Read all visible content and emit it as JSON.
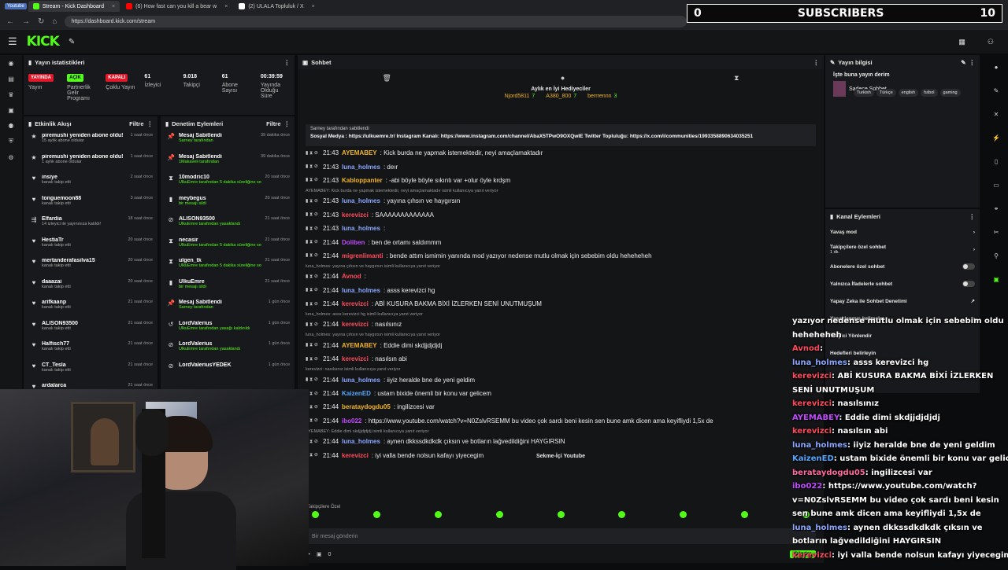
{
  "browser": {
    "tabs": [
      {
        "label": "Youtube",
        "kind": "badge"
      },
      {
        "label": "Stream - Kick Dashboard",
        "active": true,
        "color": "#53fc18"
      },
      {
        "label": "(6) How fast can you kill a bear w",
        "color": "#ff0000"
      },
      {
        "label": "(2) ULALA Topluluk / X",
        "color": "#ffffff"
      }
    ],
    "url": "https://dashboard.kick.com/stream"
  },
  "app": {
    "logo": "KICK"
  },
  "subscribers": {
    "left": "0",
    "label": "SUBSCRIBERS",
    "right": "10"
  },
  "stats": {
    "title": "Yayın istatistikleri",
    "items": [
      {
        "badge": "YAYINDA",
        "label": "Yayın",
        "color": "#e0182a"
      },
      {
        "badge": "AÇIK",
        "label": "Partnerlik Gelir Programı",
        "color": "#53fc18"
      },
      {
        "badge": "KAPALI",
        "label": "Çoklu Yayın",
        "color": "#e0182a"
      },
      {
        "value": "61",
        "label": "İzleyici"
      },
      {
        "value": "9.018",
        "label": "Takipçi"
      },
      {
        "value": "61",
        "label": "Abone Sayısı"
      },
      {
        "value": "00:39:59",
        "label": "Yayında Olduğu Süre"
      }
    ]
  },
  "feed": {
    "title": "Etkinlik Akışı",
    "filter": "Filtre",
    "items": [
      {
        "name": "piremushi yeniden abone oldu!",
        "sub": "15 aylık abone oldular",
        "time": "1 saat önce",
        "icon": "star"
      },
      {
        "name": "piremushi yeniden abone oldu!",
        "sub": "1 aylık abone oldular",
        "time": "1 saat önce",
        "icon": "star"
      },
      {
        "name": "insiye",
        "sub": "kanalı takip etti",
        "time": "2 saat önce",
        "icon": "heart"
      },
      {
        "name": "tonguemoon88",
        "sub": "kanalı takip etti",
        "time": "3 saat önce",
        "icon": "heart"
      },
      {
        "name": "Elfardia",
        "sub": "14 izleyici ile yayınınıza katıldı!",
        "time": "18 saat önce",
        "icon": "raid"
      },
      {
        "name": "HestiaTr",
        "sub": "kanalı takip etti",
        "time": "20 saat önce",
        "icon": "heart"
      },
      {
        "name": "mertanderafasilva15",
        "sub": "kanalı takip etti",
        "time": "20 saat önce",
        "icon": "heart"
      },
      {
        "name": "daaazai",
        "sub": "kanalı takip etti",
        "time": "20 saat önce",
        "icon": "heart"
      },
      {
        "name": "arifkaanp",
        "sub": "kanalı takip etti",
        "time": "21 saat önce",
        "icon": "heart"
      },
      {
        "name": "ALISON93500",
        "sub": "kanalı takip etti",
        "time": "21 saat önce",
        "icon": "heart"
      },
      {
        "name": "Halfisch77",
        "sub": "kanalı takip etti",
        "time": "21 saat önce",
        "icon": "heart"
      },
      {
        "name": "CT_Tesla",
        "sub": "kanalı takip etti",
        "time": "21 saat önce",
        "icon": "heart"
      },
      {
        "name": "ardalarca",
        "sub": "",
        "time": "21 saat önce",
        "icon": "heart"
      }
    ]
  },
  "mod": {
    "title": "Denetim Eylemleri",
    "filter": "Filtre",
    "items": [
      {
        "name": "Mesaj Sabitlendi",
        "sub": "Sarney tarafından",
        "time": "39 dakika önce",
        "icon": "pin"
      },
      {
        "name": "Mesaj Sabitlendi",
        "sub": "1Makaveli tarafından",
        "time": "39 dakika önce",
        "icon": "pin"
      },
      {
        "name": "10modric10",
        "sub": "UlkuEmre tarafından 5 dakika süreliğine sohbetten uzaklaştırıldı",
        "time": "20 saat önce",
        "icon": "timer"
      },
      {
        "name": "meybegus",
        "sub": "bir mesajı sildi",
        "time": "20 saat önce",
        "icon": "trash"
      },
      {
        "name": "ALISON93500",
        "sub": "UlkuEmre tarafından yasaklandı",
        "time": "21 saat önce",
        "icon": "ban"
      },
      {
        "name": "necasir",
        "sub": "UlkuEmre tarafından 5 dakika süreliğine sohbetten uzaklaştırıldı",
        "time": "21 saat önce",
        "icon": "timer"
      },
      {
        "name": "ulgen_tk",
        "sub": "UlkuEmre tarafından 5 dakika süreliğine sohbetten uzaklaştırıldı",
        "time": "21 saat önce",
        "icon": "timer"
      },
      {
        "name": "UlkuEmre",
        "sub": "bir mesajı sildi",
        "time": "21 saat önce",
        "icon": "trash"
      },
      {
        "name": "Mesaj Sabitlendi",
        "sub": "Sarney tarafından",
        "time": "1 gün önce",
        "icon": "pin"
      },
      {
        "name": "LordValerius",
        "sub": "UlkuEmre tarafından yasağı kaldırıldı",
        "time": "1 gün önce",
        "icon": "unban"
      },
      {
        "name": "LordValerius",
        "sub": "UlkuEmre tarafından yasaklandı",
        "time": "1 gün önce",
        "icon": "ban"
      },
      {
        "name": "LordValeriusYEDEK",
        "sub": "",
        "time": "1 gün önce",
        "icon": "ban"
      }
    ]
  },
  "chat": {
    "title": "Sohbet",
    "gifters_title": "Aylık en İyi Hediyeciler",
    "gifters": [
      {
        "name": "Njord5811",
        "count": "7"
      },
      {
        "name": "A380_800",
        "count": "7"
      },
      {
        "name": "berrrennn",
        "count": "3"
      }
    ],
    "pinned_by": "Sarney tarafından sabitlendi",
    "pinned_text": "Sosyal Medya : https://ulkuemre.tr/ Instagram Kanalı: https://www.instagram.com/channel/AbaX5TPwO9OXQwIE Twitter Topluluğu: https://x.com/i/communities/1993358890634035251",
    "messages": [
      {
        "time": "21:43",
        "user": "AYEMABEY",
        "color": "#f0b429",
        "text": ": Kick burda ne yapmak istemektedir, neyi amaçlamaktadır"
      },
      {
        "time": "21:43",
        "user": "luna_holmes",
        "color": "#8aa7ff",
        "text": ": deır"
      },
      {
        "time": "21:43",
        "user": "Kabloppanter",
        "color": "#f0b429",
        "text": ": -abi böyle böyle sıkıntı var +olur öyle krdşm"
      },
      {
        "reply": "AYEMABEY: Kick burda ne yapmak istemektedir, neyi amaçlamaktadır isimli kullanıcıya yanıt veriyor"
      },
      {
        "time": "21:43",
        "user": "luna_holmes",
        "color": "#8aa7ff",
        "text": ": yayına çıhsın ve haygırsın"
      },
      {
        "time": "21:43",
        "user": "kerevizci",
        "color": "#ff4b5c",
        "text": ": SAAAAAAAAAAAAA"
      },
      {
        "time": "21:43",
        "user": "luna_holmes",
        "color": "#8aa7ff",
        "text": ":"
      },
      {
        "time": "21:44",
        "user": "Doliben",
        "color": "#c24bff",
        "text": ": ben de ortamı saldımmm"
      },
      {
        "time": "21:44",
        "user": "migrenlimanti",
        "color": "#ff4b5c",
        "text": ": bende attım ismimin yanında mod yazıyor nedense mutlu olmak için sebebim oldu heheheheh"
      },
      {
        "reply": "luna_holmes: yayına çıhsın ve haygırsın isimli kullanıcıya yanıt veriyor"
      },
      {
        "time": "21:44",
        "user": "Avnod",
        "color": "#ff4b5c",
        "text": ":"
      },
      {
        "time": "21:44",
        "user": "luna_holmes",
        "color": "#8aa7ff",
        "text": ": asss kerevizci hg"
      },
      {
        "time": "21:44",
        "user": "kerevizci",
        "color": "#ff4b5c",
        "text": ": ABİ KUSURA BAKMA BİXİ İZLERKEN SENİ UNUTMUŞUM"
      },
      {
        "reply": "luna_holmes: asss kerevizci hg isimli kullanıcıya yanıt veriyor"
      },
      {
        "time": "21:44",
        "user": "kerevizci",
        "color": "#ff4b5c",
        "text": ": nasılsınız"
      },
      {
        "reply": "luna_holmes: yayına çıhsın ve haygırsın isimli kullanıcıya yanıt veriyor"
      },
      {
        "time": "21:44",
        "user": "AYEMABEY",
        "color": "#f0b429",
        "text": ": Eddie dimi skdjjdjdjdj"
      },
      {
        "time": "21:44",
        "user": "kerevizci",
        "color": "#ff4b5c",
        "text": ": nasılsın abi"
      },
      {
        "reply": "kerevizci: nasılsınız isimli kullanıcıya yanıt veriyor"
      },
      {
        "time": "21:44",
        "user": "luna_holmes",
        "color": "#8aa7ff",
        "text": ": iiyiz heralde bne de yeni geldim"
      },
      {
        "time": "21:44",
        "user": "KaizenED",
        "color": "#53a8ff",
        "text": ": ustam bixide önemli bir konu var gelicem"
      },
      {
        "time": "21:44",
        "user": "berataydogdu05",
        "color": "#f0b429",
        "text": ": ingilizcesi var"
      },
      {
        "time": "21:44",
        "user": "ibo022",
        "color": "#c24bff",
        "text": ": https://www.youtube.com/watch?v=N0ZslvRSEMM bu video çok sardı beni kesin sen bune amk dicen ama keyifliydi 1,5x de"
      },
      {
        "reply": "AYEMABEY: Eddie dimi skdjjdjdjdj isimli kullanıcıya yanıt veriyor"
      },
      {
        "time": "21:44",
        "user": "luna_holmes",
        "color": "#8aa7ff",
        "text": ": aynen dkkssdkdkdk çıksın ve botların lağvedildiğini HAYGIRSIN"
      },
      {
        "time": "21:44",
        "user": "kerevizci",
        "color": "#ff4b5c",
        "text": ": iyi valla bende nolsun kafayı yiyecegim"
      }
    ],
    "embed_label": "Sekme-İçi Youtube",
    "followers_only": "Takipçilere Özel",
    "input_placeholder": "Bir mesaj gönderin",
    "count": "0",
    "send": "Gönder"
  },
  "info": {
    "title": "Yayın bilgisi",
    "stream_title": "İşte buna yayın derim",
    "category": "Sadece Sohbet",
    "tags": [
      "Turkish",
      "Türkçe",
      "english",
      "futbol",
      "gaming"
    ]
  },
  "actions": {
    "title": "Kanal Eylemleri",
    "items": [
      {
        "label": "Yavaş mod",
        "kind": "arrow"
      },
      {
        "label": "Takipçilere özel sohbet",
        "sub": "1 dk.",
        "kind": "arrow"
      },
      {
        "label": "Abonelere özel sohbet",
        "kind": "toggle"
      },
      {
        "label": "Yalnızca İfadelerle sohbet",
        "kind": "toggle"
      },
      {
        "label": "Yapay Zeka ile Sohbet Denetimi",
        "kind": "link"
      },
      {
        "label": "Yasaklanmış kelimeler",
        "kind": "arrow"
      },
      {
        "label": "İzleyici Yönlendir",
        "kind": "none"
      },
      {
        "label": "Hedefleri belirleyin",
        "kind": "none"
      }
    ]
  },
  "overlay": [
    {
      "user": "",
      "text": "yazıyor nedense mutlu olmak için sebebim oldu heheheheh",
      "color": "#ffffff",
      "wrap": true
    },
    {
      "user": "Avnod",
      "text": ":",
      "color": "#ff4b5c"
    },
    {
      "user": "luna_holmes",
      "text": ": asss kerevizci hg",
      "color": "#8aa7ff"
    },
    {
      "user": "kerevizci",
      "text": ": ABİ KUSURA BAKMA BİXİ İZLERKEN SENİ UNUTMUŞUM",
      "color": "#ff4b5c",
      "wrap": true
    },
    {
      "user": "kerevizci",
      "text": ": nasılsınız",
      "color": "#ff4b5c"
    },
    {
      "user": "AYEMABEY",
      "text": ": Eddie dimi skdjjdjdjdj",
      "color": "#c24bff"
    },
    {
      "user": "kerevizci",
      "text": ": nasılsın abi",
      "color": "#ff4b5c"
    },
    {
      "user": "luna_holmes",
      "text": ": iiyiz heralde bne de yeni geldim",
      "color": "#8aa7ff"
    },
    {
      "user": "KaizenED",
      "text": ": ustam bixide önemli bir konu var gelicem",
      "color": "#53a8ff"
    },
    {
      "user": "berataydogdu05",
      "text": ": ingilizcesi var",
      "color": "#ff6b9d"
    },
    {
      "user": "ibo022",
      "text": ": https://www.youtube.com/watch?v=N0ZslvRSEMM bu video çok sardı beni kesin sen bune amk dicen ama keyifliydi 1,5x de",
      "color": "#c24bff",
      "wrap": true
    },
    {
      "user": "luna_holmes",
      "text": ": aynen dkkssdkdkdk çıksın ve botların lağvedildiğini HAYGIRSIN",
      "color": "#8aa7ff",
      "wrap": true
    },
    {
      "user": "kerevizci",
      "text": ": iyi valla bende nolsun kafayı yiyecegim",
      "color": "#ff4b5c"
    }
  ]
}
